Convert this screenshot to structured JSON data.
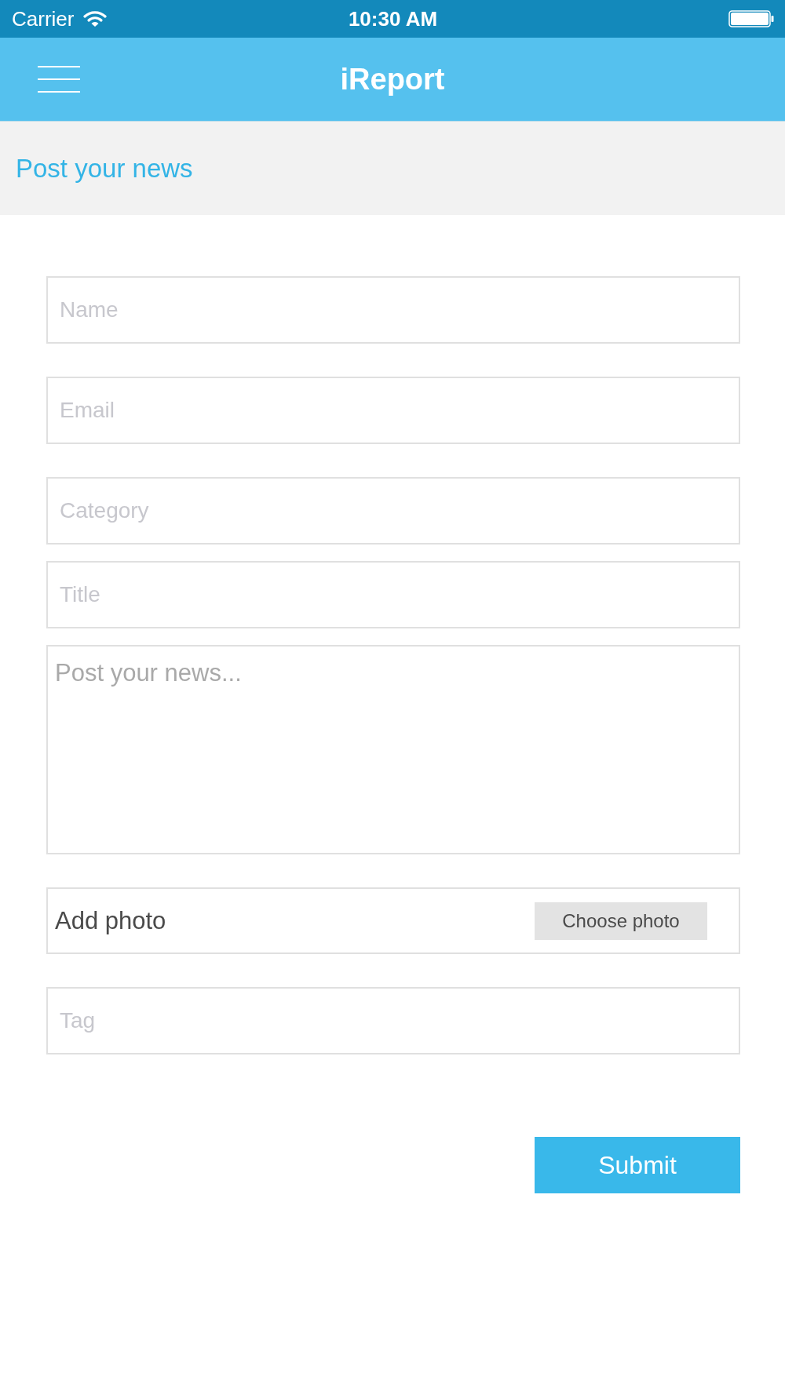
{
  "status_bar": {
    "carrier": "Carrier",
    "time": "10:30 AM"
  },
  "nav_bar": {
    "title": "iReport"
  },
  "header": {
    "title": "Post your news"
  },
  "form": {
    "sections": [
      {
        "fields": [
          {
            "kind": "text",
            "placeholder": "Name"
          }
        ]
      },
      {
        "fields": [
          {
            "kind": "text",
            "placeholder": "Email"
          }
        ]
      },
      {
        "fields": [
          {
            "kind": "text",
            "placeholder": "Category"
          },
          {
            "kind": "text",
            "placeholder": "Title"
          },
          {
            "kind": "textarea",
            "placeholder": "Post your news..."
          }
        ]
      },
      {
        "fields": [
          {
            "kind": "photo",
            "label": "Add photo",
            "button": "Choose photo"
          }
        ]
      },
      {
        "fields": [
          {
            "kind": "text",
            "placeholder": "Tag"
          }
        ]
      }
    ],
    "submit": "Submit"
  }
}
